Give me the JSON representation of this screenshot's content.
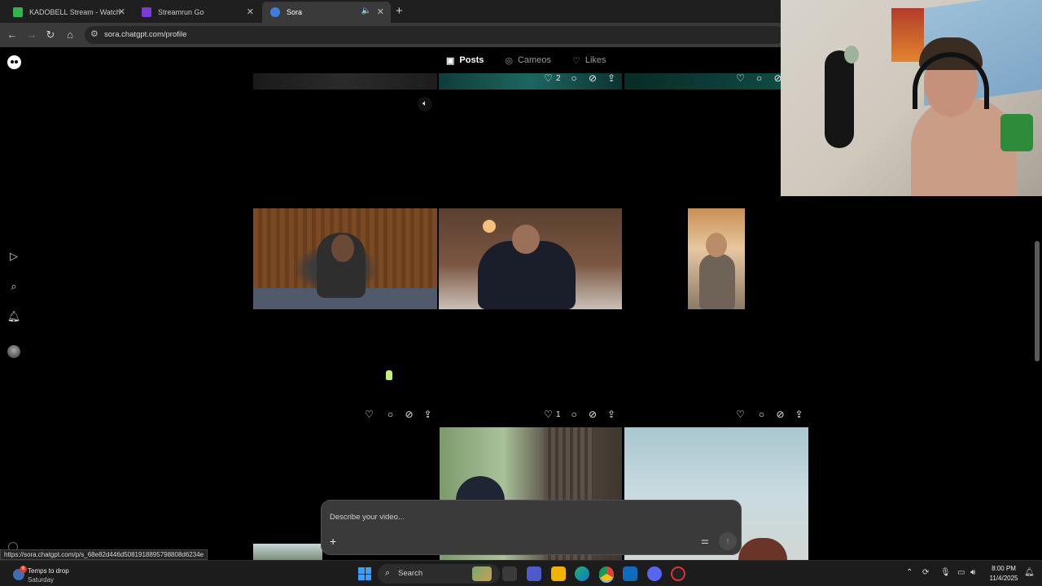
{
  "browser": {
    "tabs": [
      {
        "title": "KADOBELL Stream - Watch Live",
        "favicon_color": "#2ab94a"
      },
      {
        "title": "Streamrun Go",
        "favicon_color": "#7a3cd6"
      },
      {
        "title": "Sora",
        "favicon_color": "#3f7fe0"
      }
    ],
    "url": "sora.chatgpt.com/profile",
    "status_url": "https://sora.chatgpt.com/p/s_68e82d446d5081918895798808d6234e"
  },
  "profile_tabs": [
    {
      "label": "Posts",
      "icon": "play-square-icon",
      "active": true
    },
    {
      "label": "Cameos",
      "icon": "person-circle-icon",
      "active": false
    },
    {
      "label": "Likes",
      "icon": "heart-icon",
      "active": false
    }
  ],
  "posts": {
    "row1_actions": [
      {
        "likes": "2"
      },
      {
        "likes": ""
      }
    ],
    "row2_actions": [
      {
        "likes": ""
      },
      {
        "likes": "1"
      },
      {
        "likes": ""
      }
    ]
  },
  "composer": {
    "placeholder": "Describe your video..."
  },
  "taskbar": {
    "weather_title": "Temps to drop",
    "weather_sub": "Saturday",
    "weather_badge": "6",
    "search_label": "Search",
    "time": "8:00 PM",
    "date": "11/4/2025"
  },
  "colors": {
    "accent": "#3f7fe0",
    "page_bg": "#000000",
    "windows_blue": "#3aa0ff"
  }
}
